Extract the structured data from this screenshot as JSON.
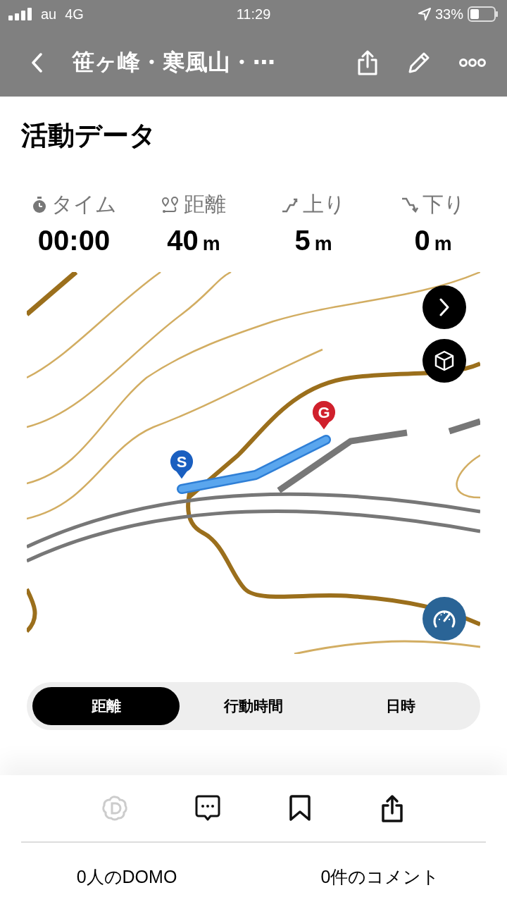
{
  "status_bar": {
    "carrier": "au",
    "network": "4G",
    "time": "11:29",
    "battery": "33%"
  },
  "nav": {
    "title": "笹ヶ峰・寒風山・⋯"
  },
  "section_title": "活動データ",
  "stats": [
    {
      "kind": "time",
      "label": "タイム",
      "value": "00:00"
    },
    {
      "kind": "distance",
      "label": "距離",
      "value": "40",
      "unit": "m"
    },
    {
      "kind": "up",
      "label": "上り",
      "value": "5",
      "unit": "m"
    },
    {
      "kind": "down",
      "label": "下り",
      "value": "0",
      "unit": "m"
    }
  ],
  "map": {
    "kind": "picture",
    "start_label": "S",
    "goal_label": "G"
  },
  "tabs": [
    {
      "label": "距離",
      "selected": true
    },
    {
      "label": "行動時間",
      "selected": false
    },
    {
      "label": "日時",
      "selected": false
    }
  ],
  "footer": {
    "domo_count": "0人のDOMO",
    "comment_count": "0件のコメント"
  }
}
